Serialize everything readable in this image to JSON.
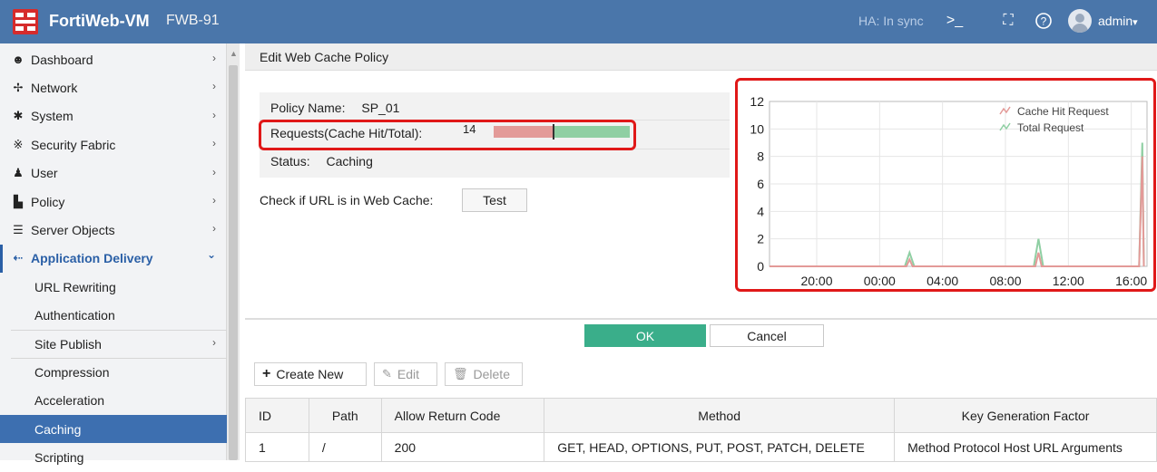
{
  "topbar": {
    "app_name": "FortiWeb-VM",
    "host_name": "FWB-91",
    "ha_status": "HA: In sync",
    "user": "admin",
    "user_chevron": "▾",
    "icons": [
      "cli-console-icon",
      "fullscreen-icon",
      "help-icon",
      "user-avatar-icon"
    ]
  },
  "sidebar": {
    "items": [
      {
        "label": "Dashboard",
        "icon": "dashboard-icon",
        "glyph": "☻"
      },
      {
        "label": "Network",
        "icon": "network-icon",
        "glyph": "✢"
      },
      {
        "label": "System",
        "icon": "gear-icon",
        "glyph": "✱"
      },
      {
        "label": "Security Fabric",
        "icon": "security-fabric-icon",
        "glyph": "※"
      },
      {
        "label": "User",
        "icon": "user-icon",
        "glyph": "♟"
      },
      {
        "label": "Policy",
        "icon": "policy-icon",
        "glyph": "▙"
      },
      {
        "label": "Server Objects",
        "icon": "server-icon",
        "glyph": "☰"
      },
      {
        "label": "Application Delivery",
        "icon": "application-delivery-icon",
        "glyph": "⇠"
      }
    ],
    "sub_items": [
      "URL Rewriting",
      "Authentication",
      "Site Publish",
      "Compression",
      "Acceleration",
      "Caching",
      "Scripting"
    ],
    "chevron": "›",
    "chevron_down": "⌄"
  },
  "page": {
    "title": "Edit Web Cache Policy",
    "policy_name_label": "Policy Name:",
    "policy_name_value": "SP_01",
    "requests_label": "Requests(Cache Hit/Total):",
    "requests_value": "14",
    "cache_hit_ratio": 0.42,
    "status_label": "Status:",
    "status_value": "Caching",
    "check_url_label": "Check if URL is in Web Cache:",
    "test_button": "Test",
    "ok_button": "OK",
    "cancel_button": "Cancel"
  },
  "toolbar": {
    "create_new": "Create New",
    "edit": "Edit",
    "delete": "Delete"
  },
  "table": {
    "columns": [
      "ID",
      "Path",
      "Allow Return Code",
      "Method",
      "Key Generation Factor"
    ],
    "rows": [
      [
        "1",
        "/",
        "200",
        "GET, HEAD, OPTIONS, PUT, POST, PATCH, DELETE",
        "Method Protocol Host URL Arguments"
      ]
    ]
  },
  "colors": {
    "topbar": "#4a76aa",
    "cache_hit": "#e39a98",
    "total_request": "#8fcfa3",
    "ok_button": "#3aae8a",
    "highlight": "#e01818"
  },
  "chart_data": {
    "type": "line",
    "x_ticks": [
      "20:00",
      "00:00",
      "04:00",
      "08:00",
      "12:00",
      "16:00"
    ],
    "y_ticks": [
      "0",
      "2",
      "4",
      "6",
      "8",
      "10",
      "12"
    ],
    "ylim": [
      0,
      12
    ],
    "xlim_hours": [
      17,
      41
    ],
    "grid": true,
    "legend_position": "top-right",
    "series": [
      {
        "name": "Cache Hit Request",
        "color": "#e39a98",
        "points": [
          [
            17,
            0
          ],
          [
            25.7,
            0
          ],
          [
            25.9,
            0.5
          ],
          [
            26.1,
            0
          ],
          [
            33.9,
            0
          ],
          [
            34.1,
            1
          ],
          [
            34.3,
            0
          ],
          [
            40.5,
            0
          ],
          [
            40.7,
            8
          ],
          [
            40.8,
            0
          ]
        ]
      },
      {
        "name": "Total Request",
        "color": "#8fcfa3",
        "points": [
          [
            17,
            0
          ],
          [
            25.6,
            0
          ],
          [
            25.9,
            1
          ],
          [
            26.2,
            0
          ],
          [
            33.8,
            0
          ],
          [
            34.1,
            2
          ],
          [
            34.4,
            0
          ],
          [
            40.5,
            0
          ],
          [
            40.7,
            9
          ],
          [
            40.8,
            0
          ]
        ]
      }
    ]
  }
}
